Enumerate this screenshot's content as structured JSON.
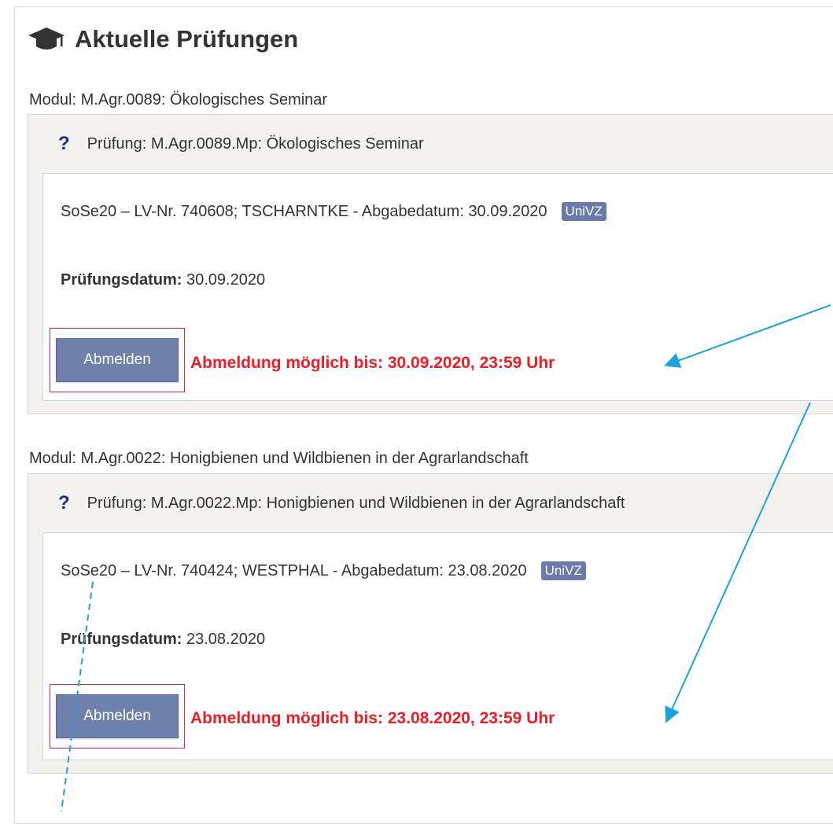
{
  "header": {
    "title": "Aktuelle Prüfungen",
    "icon": "graduation-cap-icon"
  },
  "modules": [
    {
      "module_label": "Modul: M.Agr.0089: Ökologisches Seminar",
      "exam_title": "Prüfung: M.Agr.0089.Mp: Ökologisches Seminar",
      "help_icon": "?",
      "course_info": "SoSe20 – LV-Nr. 740608; TSCHARNTKE - Abgabedatum: 30.09.2020",
      "badge": "UniVZ",
      "date_label": "Prüfungsdatum:",
      "date_value": "30.09.2020",
      "button_label": "Abmelden",
      "deadline": "Abmeldung möglich bis: 30.09.2020, 23:59 Uhr"
    },
    {
      "module_label": "Modul: M.Agr.0022: Honigbienen und Wildbienen in der Agrarlandschaft",
      "exam_title": "Prüfung: M.Agr.0022.Mp: Honigbienen und Wildbienen in der Agrarlandschaft",
      "help_icon": "?",
      "course_info": "SoSe20 – LV-Nr. 740424; WESTPHAL - Abgabedatum: 23.08.2020",
      "badge": "UniVZ",
      "date_label": "Prüfungsdatum:",
      "date_value": "23.08.2020",
      "button_label": "Abmelden",
      "deadline": "Abmeldung möglich bis: 23.08.2020, 23:59 Uhr"
    }
  ],
  "colors": {
    "deadline": "#ee1c25",
    "button": "#6f80ac",
    "badge": "#6a7bab",
    "highlight": "#e0262b",
    "arrow": "#1ba1e2"
  }
}
